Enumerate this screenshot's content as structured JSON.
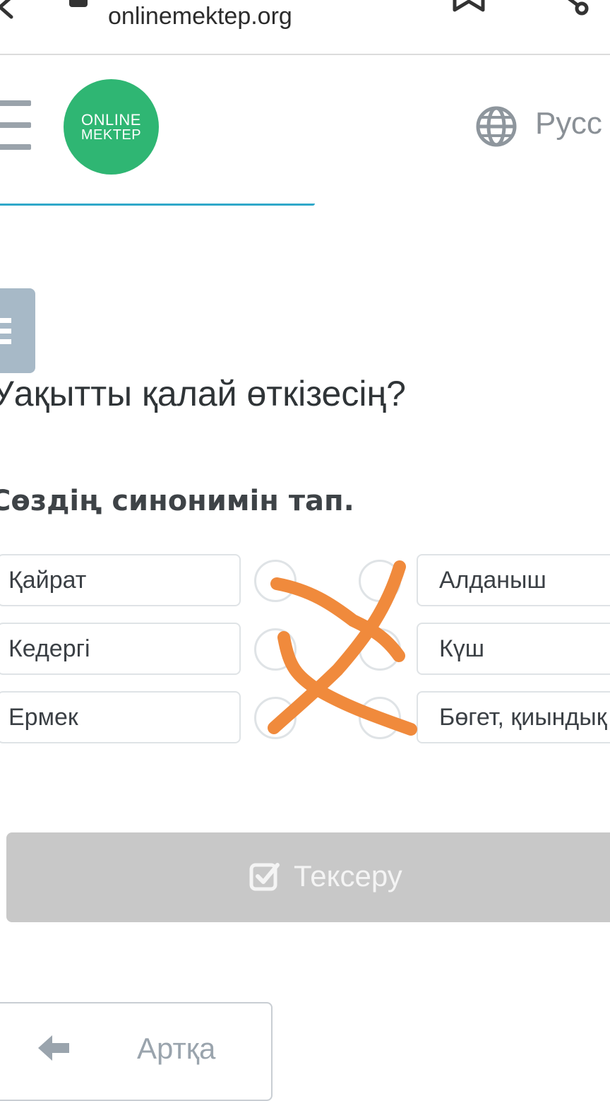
{
  "browser": {
    "url": "onlinemektep.org",
    "icons": [
      "back-icon",
      "tabs-icon",
      "bookmark-icon",
      "share-icon"
    ]
  },
  "header": {
    "logo": {
      "line1": "ONLINE",
      "line2": "MEKTEP",
      "color": "#2fb673"
    },
    "language_label": "Русс",
    "icons": [
      "menu-icon",
      "globe-icon"
    ]
  },
  "lesson": {
    "title": "Уақытты қалай өткізесің?",
    "instruction": "Сөздің синонимін тап."
  },
  "matching": {
    "left_words": [
      "Қайрат",
      "Кедергі",
      "Ермек"
    ],
    "right_words": [
      "Алданыш",
      "Күш",
      "Бөгет, қиындық"
    ],
    "annotation_color": "#f08a3c"
  },
  "actions": {
    "check_label": "Тексеру",
    "back_label": "Артқа"
  },
  "colors": {
    "accent": "#2fa8c9",
    "disabled_button": "#c8c8c8",
    "badge": "#a7b9c7"
  }
}
